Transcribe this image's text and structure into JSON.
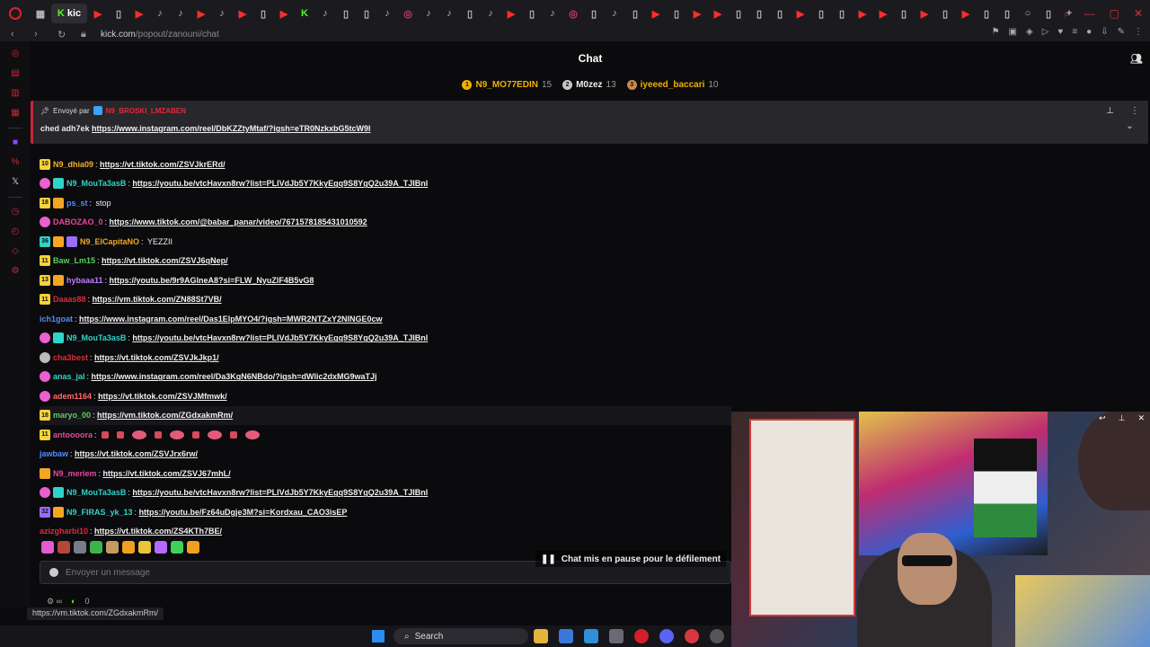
{
  "browser": {
    "url_domain": "kick.com",
    "url_path": "/popout/zanouni/chat",
    "active_tab_label": "kic"
  },
  "chat": {
    "title": "Chat",
    "leaderboard": [
      {
        "rank_icon": "gold-medal-icon",
        "name": "N9_MO77EDIN",
        "count": "15",
        "color": "#f1b000"
      },
      {
        "rank_icon": "silver-medal-icon",
        "name": "M0zez",
        "count": "13",
        "color": "#f0f0f0"
      },
      {
        "rank_icon": "bronze-medal-icon",
        "name": "iyeeed_baccari",
        "count": "10",
        "color": "#f1b000"
      }
    ],
    "pinned": {
      "label": "Envoyé par",
      "sender": "N9_BROSKI_LMZABEN",
      "prefix": "ched adh7ek",
      "link": "https://www.instagram.com/reel/DbKZZtyMtaf/?igsh=eTR0NzkxbG5tcW9l"
    },
    "messages": [
      {
        "badge": "10",
        "user": "N9_dhia09",
        "color": "#f5b02e",
        "link": "https://vt.tiktok.com/ZSVJkrERd/"
      },
      {
        "badge": "",
        "user": "N9_MouTa3asB",
        "color": "#2fd3c8",
        "link": "https://youtu.be/vtcHavxn8rw?list=PLIVdJb5Y7KkyEgq9S8YgQ2u39A_TJIBnl"
      },
      {
        "badge": "18",
        "user": "ps_st",
        "color": "#4f8cff",
        "text": "stop"
      },
      {
        "badge": "",
        "user": "DABOZAO_0",
        "color": "#e8469d",
        "link": "https://www.tiktok.com/@babar_panar/video/7671578185431010592"
      },
      {
        "badge": "36",
        "user": "N9_ElCapitaNO",
        "color": "#f5a524",
        "text": "YEZZII"
      },
      {
        "badge": "11",
        "user": "Baw_Lm15",
        "color": "#53d35a",
        "link": "https://vt.tiktok.com/ZSVJ6qNep/"
      },
      {
        "badge": "13",
        "user": "hybaaa11",
        "color": "#c07bff",
        "link": "https://youtu.be/9r9AGlneA8?si=FLW_NyuZlF4B5vG8"
      },
      {
        "badge": "11",
        "user": "Daaas88",
        "color": "#e02a3a",
        "link": "https://vm.tiktok.com/ZN88St7VB/"
      },
      {
        "badge": "",
        "user": "ich1goat",
        "color": "#4f8cff",
        "link": "https://www.instagram.com/reel/Das1ElpMYO4/?igsh=MWR2NTZxY2NINGE0cw"
      },
      {
        "badge": "",
        "user": "N9_MouTa3asB",
        "color": "#2fd3c8",
        "link": "https://youtu.be/vtcHavxn8rw?list=PLIVdJb5Y7KkyEgq9S8YgQ2u39A_TJIBnl"
      },
      {
        "badge": "",
        "user": "cha3best",
        "color": "#e02a3a",
        "link": "https://vt.tiktok.com/ZSVJkJkp1/"
      },
      {
        "badge": "",
        "user": "anas_jal",
        "color": "#2fd3c8",
        "link": "https://www.instagram.com/reel/Da3KgN6NBdo/?igsh=dWlic2dxMG9waTJj"
      },
      {
        "badge": "",
        "user": "adem1164",
        "color": "#ff6b6b",
        "link": "https://vt.tiktok.com/ZSVJMfmwk/"
      },
      {
        "badge": "18",
        "user": "maryo_00",
        "color": "#53d35a",
        "link": "https://vm.tiktok.com/ZGdxakmRm/"
      },
      {
        "badge": "11",
        "user": "antoooora",
        "color": "#e8469d",
        "emotes": true
      },
      {
        "badge": "",
        "user": "jawbaw",
        "color": "#4f8cff",
        "link": "https://vt.tiktok.com/ZSVJrx6rw/"
      },
      {
        "badge": "",
        "user": "N9_meriem",
        "color": "#e8469d",
        "link": "https://vt.tiktok.com/ZSVJ67mhL/"
      },
      {
        "badge": "",
        "user": "N9_MouTa3asB",
        "color": "#2fd3c8",
        "link": "https://youtu.be/vtcHavxn8rw?list=PLIVdJb5Y7KkyEgq9S8YgQ2u39A_TJIBnl"
      },
      {
        "badge": "32",
        "user": "N9_FIRAS_yk_13",
        "color": "#2fd3c8",
        "link": "https://youtu.be/Fz64uDgje3M?si=Kordxau_CAO3isEP"
      },
      {
        "badge": "",
        "user": "azizgharbi10",
        "color": "#e02a3a",
        "link": "https://vt.tiktok.com/ZS4KTh7BE/"
      }
    ],
    "paused_text": "Chat mis en pause pour le défilement",
    "input_placeholder": "Envoyer un message",
    "footer_count": "0",
    "status_url": "https://vm.tiktok.com/ZGdxakmRm/"
  },
  "taskbar": {
    "search_label": "Search"
  }
}
